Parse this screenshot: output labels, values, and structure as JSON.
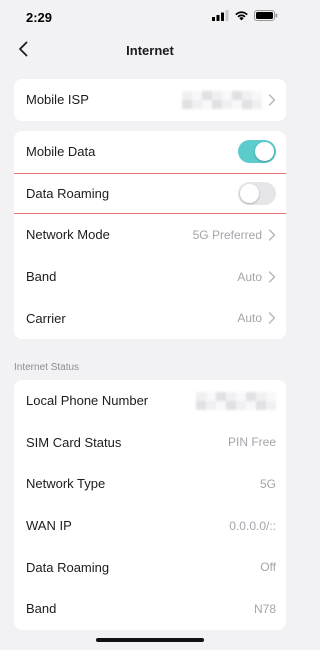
{
  "status": {
    "time": "2:29",
    "icons": [
      "signal-icon",
      "wifi-icon",
      "battery-icon"
    ]
  },
  "nav": {
    "title": "Internet",
    "back_icon": "chevron-left-icon"
  },
  "isp": {
    "label": "Mobile ISP",
    "value_redacted": true
  },
  "connection": {
    "mobile_data": {
      "label": "Mobile Data",
      "on": true
    },
    "data_roaming": {
      "label": "Data Roaming",
      "on": false
    },
    "network_mode": {
      "label": "Network Mode",
      "value": "5G Preferred"
    },
    "band": {
      "label": "Band",
      "value": "Auto"
    },
    "carrier": {
      "label": "Carrier",
      "value": "Auto"
    }
  },
  "internet_status": {
    "section_title": "Internet Status",
    "local_phone": {
      "label": "Local Phone Number",
      "value_redacted": true
    },
    "sim_status": {
      "label": "SIM Card Status",
      "value": "PIN Free"
    },
    "network_type": {
      "label": "Network Type",
      "value": "5G"
    },
    "wan_ip": {
      "label": "WAN IP",
      "value": "0.0.0.0/::"
    },
    "data_roaming": {
      "label": "Data Roaming",
      "value": "Off"
    },
    "band": {
      "label": "Band",
      "value": "N78"
    }
  },
  "colors": {
    "accent": "#5ccbcb",
    "highlight_border": "#e57373",
    "background": "#f2f2f4"
  }
}
